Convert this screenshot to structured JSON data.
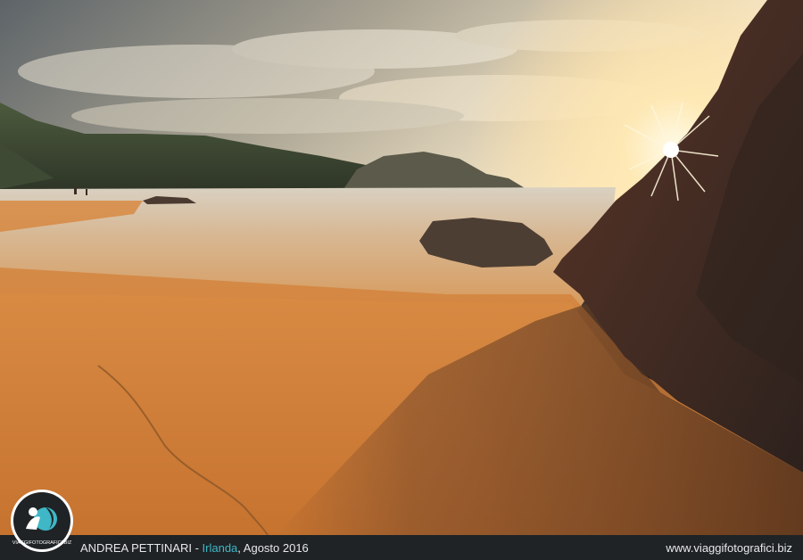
{
  "caption": {
    "author": "ANDREA PETTINARI",
    "separator": " - ",
    "place": "Irlanda",
    "date": ", Agosto 2016",
    "website": "www.viaggifotografici.biz"
  },
  "logo": {
    "text": "VIAGGIFOTOGRAFICI.BIZ"
  },
  "colors": {
    "accent": "#3fb7c6",
    "bar": "#1f2326",
    "sand": "#d9883f",
    "sky": "#c9c2b0"
  }
}
